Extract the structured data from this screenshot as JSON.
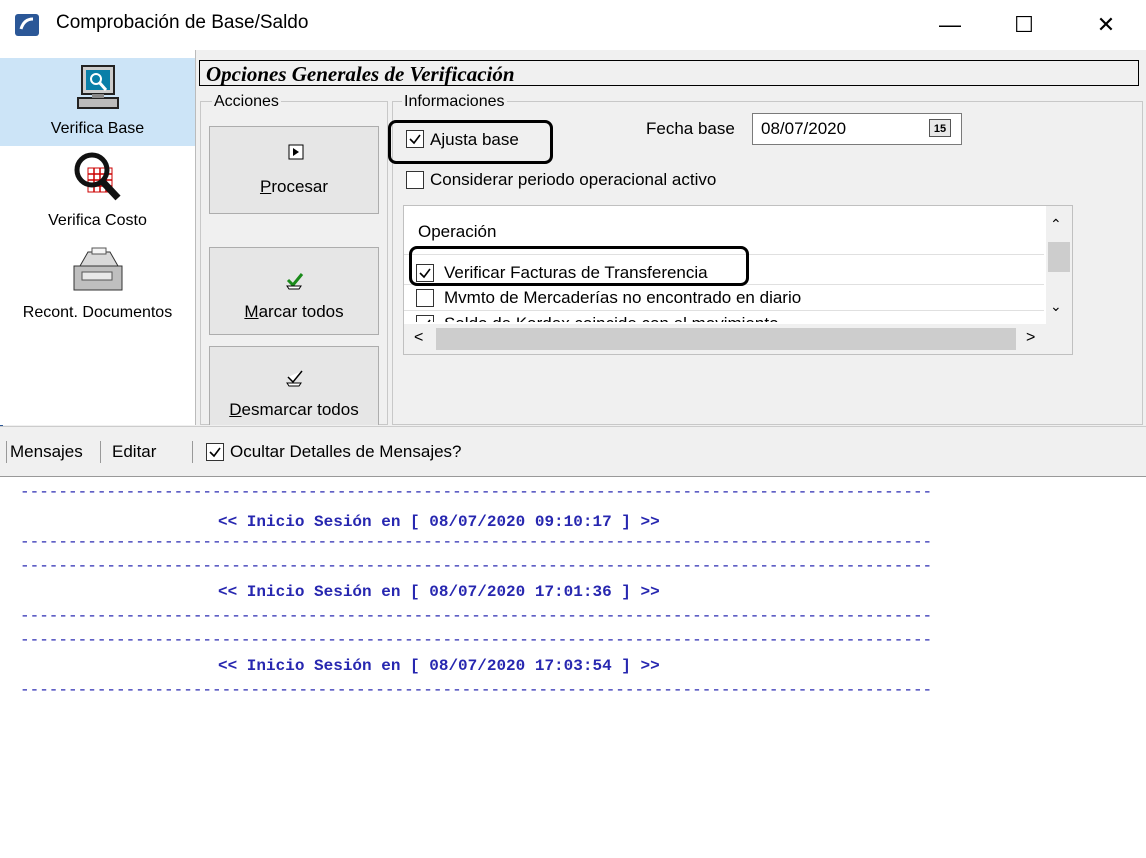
{
  "window": {
    "title": "Comprobación de Base/Saldo",
    "minimize_glyph": "—",
    "maximize_glyph": "☐",
    "close_glyph": "✕"
  },
  "sidebar": {
    "items": [
      {
        "label": "Verifica Base",
        "icon": "computer-icon",
        "active": true
      },
      {
        "label": "Verifica Costo",
        "icon": "magnifier-grid-icon",
        "active": false
      },
      {
        "label": "Recont. Documentos",
        "icon": "cash-register-icon",
        "active": false
      }
    ]
  },
  "main": {
    "section_title": "Opciones Generales de Verificación",
    "acciones": {
      "label": "Acciones",
      "buttons": [
        {
          "label_first": "P",
          "label_rest": "rocesar",
          "icon": "play-icon"
        },
        {
          "label_first": "M",
          "label_rest": "arcar todos",
          "icon": "check-mark-icon"
        },
        {
          "label_first": "D",
          "label_rest": "esmarcar todos",
          "icon": "uncheck-mark-icon"
        }
      ]
    },
    "informaciones": {
      "label": "Informaciones",
      "ajusta_base": {
        "label": "Ajusta base",
        "checked": true
      },
      "fecha_base_label": "Fecha base",
      "fecha_base_value": "08/07/2020",
      "calendar_glyph": "15",
      "considerar": {
        "label": "Considerar periodo operacional activo",
        "checked": false
      },
      "operacion_header": "Operación",
      "operaciones": [
        {
          "label": "Verificar Facturas de Transferencia",
          "checked": true
        },
        {
          "label": "Mvmto de Mercaderías no encontrado en diario",
          "checked": false
        },
        {
          "label": "Saldo de Kardex coincide con el movimiento",
          "checked": true
        }
      ]
    }
  },
  "toolbar": {
    "mensajes": "Mensajes",
    "editar": "Editar",
    "ocultar": {
      "label": "Ocultar Detalles de Mensajes?",
      "checked": true
    }
  },
  "messages": {
    "dash_line": "-----------------------------------------------------------------------------------------------",
    "sessions": [
      "<< Inicio Sesión en [ 08/07/2020 09:10:17 ] >>",
      "<< Inicio Sesión en [ 08/07/2020 17:01:36 ] >>",
      "<< Inicio Sesión en [ 08/07/2020 17:03:54 ] >>"
    ]
  },
  "colors": {
    "message_text": "#2727b0",
    "active_nav": "#cce4f7",
    "app_icon": "#2b5797"
  }
}
